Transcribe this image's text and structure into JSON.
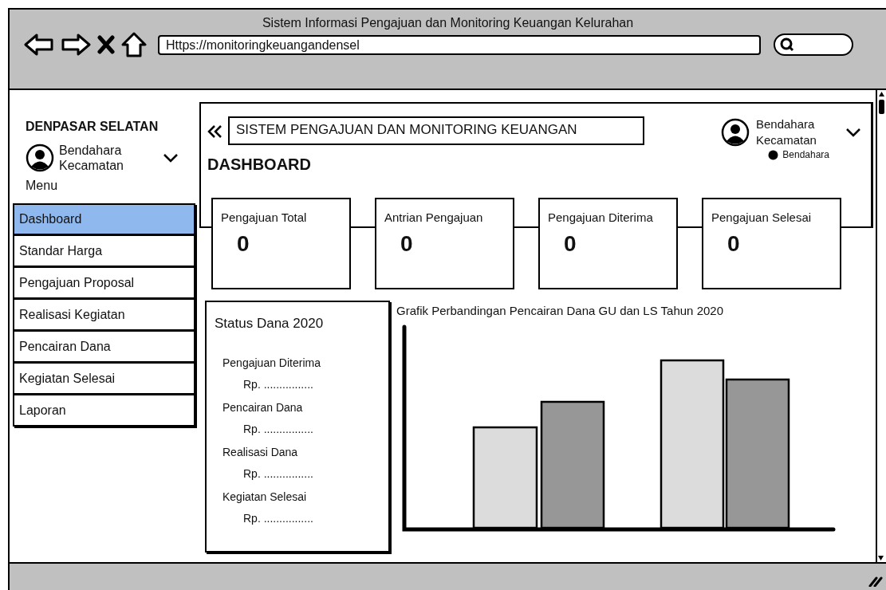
{
  "window": {
    "title": "Sistem Informasi Pengajuan dan Monitoring Keuangan Kelurahan",
    "url": "Https://monitoringkeuangandensel"
  },
  "sidebar": {
    "title": "DENPASAR SELATAN",
    "user": "Bendahara Kecamatan",
    "menu_label": "Menu",
    "items": [
      {
        "label": "Dashboard",
        "selected": true
      },
      {
        "label": "Standar Harga",
        "selected": false
      },
      {
        "label": "Pengajuan Proposal",
        "selected": false
      },
      {
        "label": "Realisasi Kegiatan",
        "selected": false
      },
      {
        "label": "Pencairan Dana",
        "selected": false
      },
      {
        "label": "Kegiatan Selesai",
        "selected": false
      },
      {
        "label": "Laporan",
        "selected": false
      }
    ]
  },
  "header": {
    "title": "SISTEM PENGAJUAN DAN MONITORING KEUANGAN",
    "user": "Bendahara Kecamatan",
    "role": "Bendahara"
  },
  "page_title": "DASHBOARD",
  "stats": [
    {
      "label": "Pengajuan Total",
      "value": "0"
    },
    {
      "label": "Antrian Pengajuan",
      "value": "0"
    },
    {
      "label": "Pengajuan Diterima",
      "value": "0"
    },
    {
      "label": "Pengajuan Selesai",
      "value": "0"
    }
  ],
  "status_card": {
    "title": "Status Dana 2020",
    "items": [
      {
        "label": "Pengajuan Diterima",
        "value": "Rp. ................"
      },
      {
        "label": "Pencairan Dana",
        "value": "Rp. ................"
      },
      {
        "label": "Realisasi Dana",
        "value": "Rp. ................"
      },
      {
        "label": "Kegiatan Selesai",
        "value": "Rp. ................"
      }
    ]
  },
  "chart": {
    "title": "Grafik Perbandingan Pencairan Dana GU dan LS Tahun 2020"
  }
}
